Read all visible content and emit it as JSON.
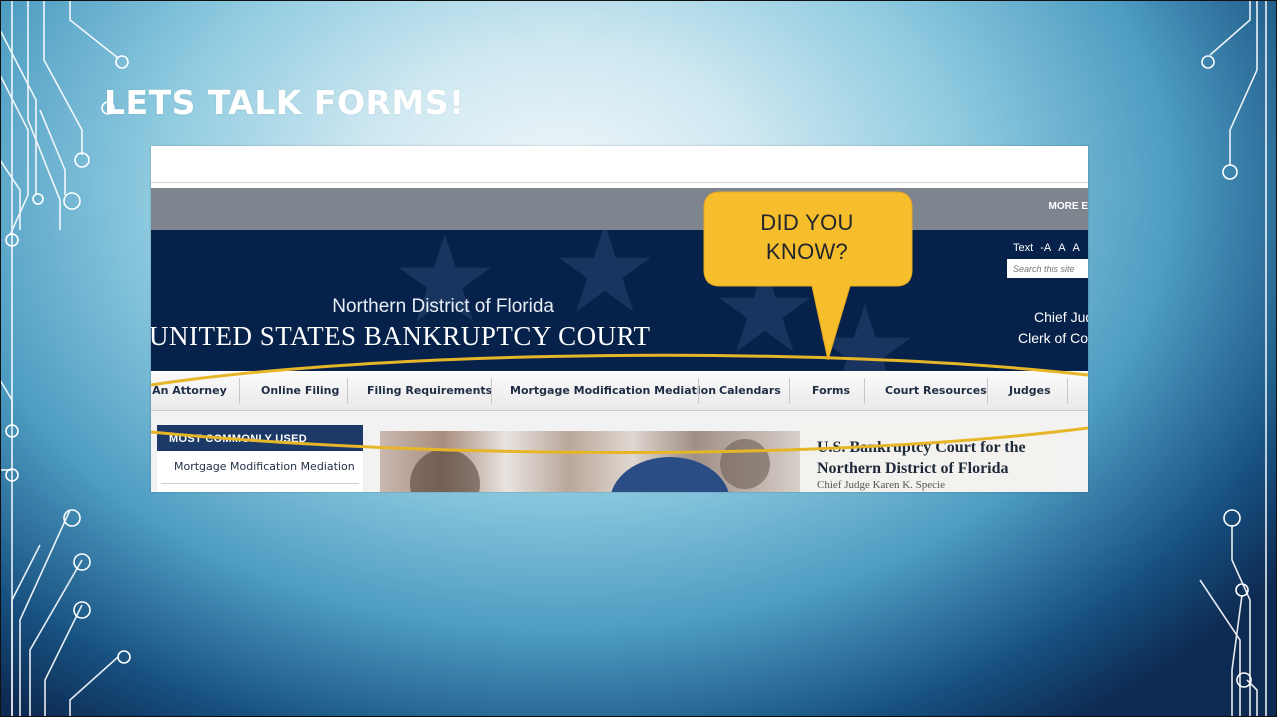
{
  "slide": {
    "title": "LETS TALK FORMS!"
  },
  "callout": {
    "line1": "DID YOU",
    "line2": "KNOW?"
  },
  "site": {
    "more_link": "MORE E",
    "text_size": {
      "label": "Text",
      "smaller": "-A",
      "normal": "A",
      "larger": "A"
    },
    "search_placeholder": "Search this site",
    "banner_subtitle": "Northern District of Florida",
    "banner_title": "UNITED STATES BANKRUPTCY COURT",
    "chief_judge": "Chief Jud",
    "clerk": "Clerk of Co",
    "nav": [
      "t An Attorney",
      "Online Filing",
      "Filing Requirements",
      "Mortgage Modification Mediation",
      "Calendars",
      "Forms",
      "Court Resources",
      "Judges"
    ],
    "most_used": {
      "heading": "MOST COMMONLY USED",
      "items": [
        "Mortgage Modification Mediation"
      ]
    },
    "welcome": {
      "line1": "U.S. Bankruptcy Court for the",
      "line2": "Northern District of Florida",
      "sub": "Chief Judge Karen K. Specie"
    }
  },
  "colors": {
    "callout": "#f6be2d",
    "highlight_ring": "#e6b628",
    "banner": "#06224b",
    "nav_text": "#1f2d44"
  },
  "icons": {
    "circuit_left": "circuit-lines-decoration",
    "circuit_right": "circuit-lines-decoration",
    "banner_stars": "star-watermark"
  }
}
